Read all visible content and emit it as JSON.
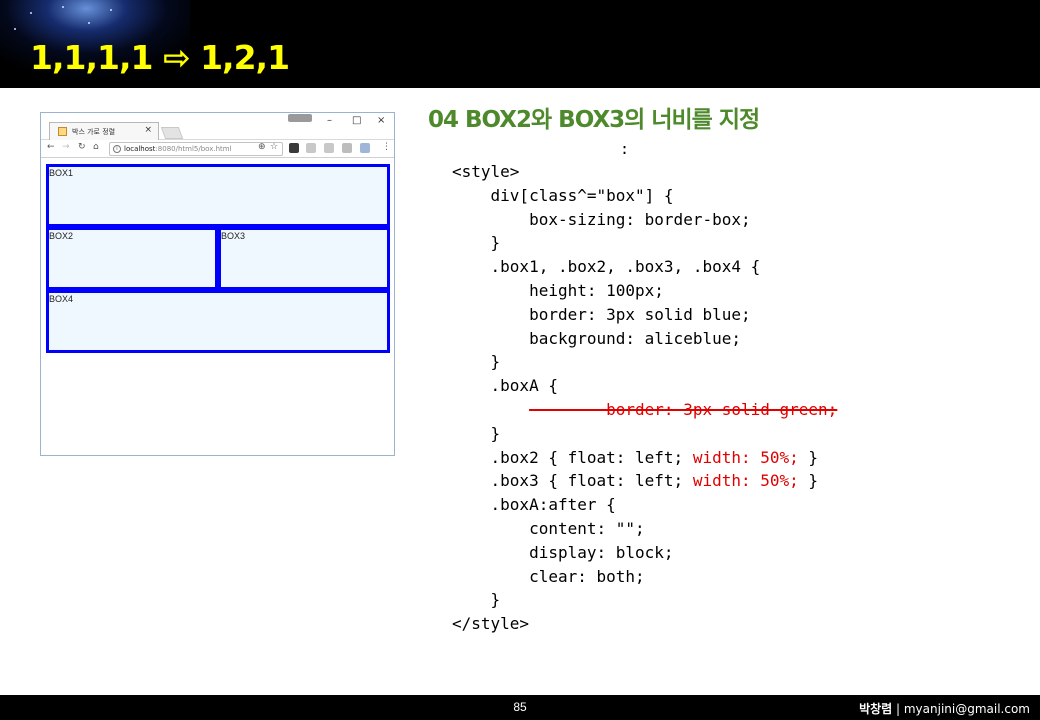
{
  "slide": {
    "title": "1,1,1,1 ⇨ 1,2,1"
  },
  "browser": {
    "tab_title": "박스 가로 정렬",
    "url_host": "localhost",
    "url_path": ":8080/html5/box.html",
    "boxes": [
      "BOX1",
      "BOX2",
      "BOX3",
      "BOX4"
    ]
  },
  "section": {
    "title": "04 BOX2와 BOX3의 너비를 지정",
    "colon": ":"
  },
  "code": {
    "lines": [
      "<style>",
      "    div[class^=\"box\"] {",
      "        box-sizing: border-box;",
      "    }",
      "    .box1, .box2, .box3, .box4 {",
      "        height: 100px;",
      "        border: 3px solid blue;",
      "        background: aliceblue;",
      "    }",
      "    .boxA {",
      "        border: 3px solid green;",
      "    }",
      "    .box2 { float: left; ",
      "width: 50%;",
      " }",
      "    .box3 { float: left; ",
      "width: 50%;",
      " }",
      "    .boxA:after {",
      "        content: \"\";",
      "        display: block;",
      "        clear: both;",
      "    }",
      "</style>"
    ]
  },
  "footer": {
    "page_number": "85",
    "author": "박창렴",
    "separator": " | ",
    "email": "myanjini@gmail.com"
  }
}
